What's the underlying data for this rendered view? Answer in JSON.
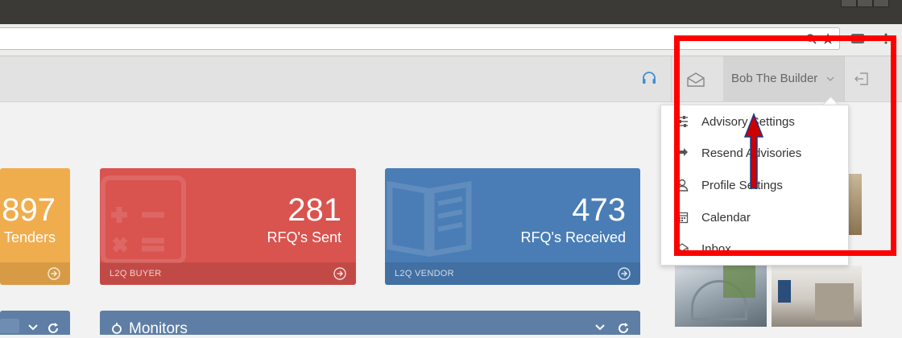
{
  "header": {
    "user_name": "Bob The Builder",
    "icons": [
      "headset-icon",
      "envelope-icon",
      "chevron-down-icon",
      "logout-icon"
    ]
  },
  "cards": [
    {
      "value": "897",
      "label": "Tenders",
      "footer": "",
      "color": "#f0ad4e"
    },
    {
      "value": "281",
      "label": "RFQ's Sent",
      "footer": "L2Q BUYER",
      "color": "#d9534f"
    },
    {
      "value": "473",
      "label": "RFQ's Received",
      "footer": "L2Q VENDOR",
      "color": "#4a7db5"
    }
  ],
  "panels": [
    {
      "title": "",
      "color": "#5e7ea6"
    },
    {
      "title": "Monitors",
      "color": "#5e7ea6"
    }
  ],
  "dropdown": {
    "items": [
      {
        "label": "Advisory Settings",
        "icon": "sliders-icon"
      },
      {
        "label": "Resend Advisories",
        "icon": "share-icon"
      },
      {
        "label": "Profile Settings",
        "icon": "user-icon"
      },
      {
        "label": "Calendar",
        "icon": "calendar-icon"
      },
      {
        "label": "Inbox",
        "icon": "inbox-icon"
      }
    ]
  },
  "annotation": {
    "box_color": "#ff0000",
    "arrow_color": "#cc0000"
  }
}
